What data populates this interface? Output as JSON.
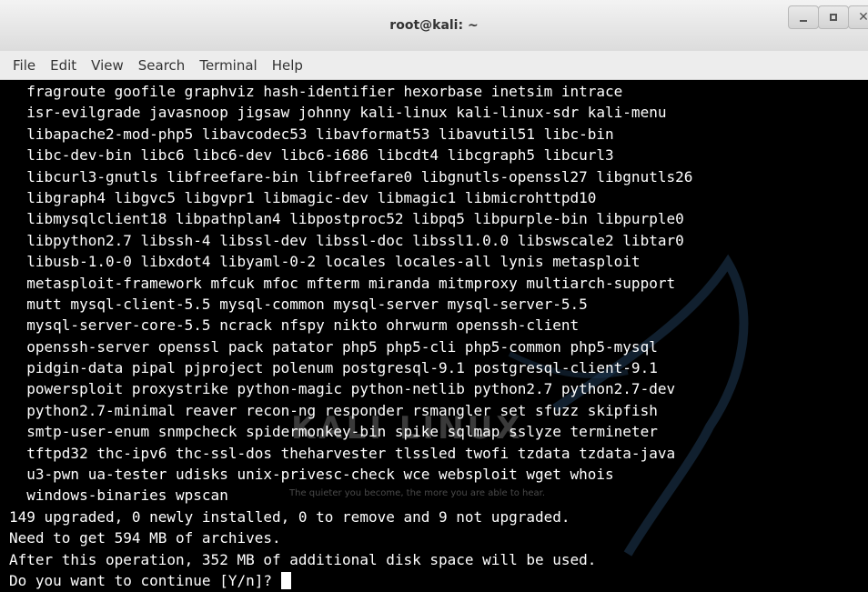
{
  "window": {
    "title": "root@kali: ~",
    "controls": {
      "minimize_glyph": "_",
      "maximize_glyph": "□",
      "close_glyph": "✕"
    }
  },
  "menubar": {
    "items": [
      "File",
      "Edit",
      "View",
      "Search",
      "Terminal",
      "Help"
    ]
  },
  "terminal": {
    "lines": [
      "  fragroute goofile graphviz hash-identifier hexorbase inetsim intrace",
      "  isr-evilgrade javasnoop jigsaw johnny kali-linux kali-linux-sdr kali-menu",
      "  libapache2-mod-php5 libavcodec53 libavformat53 libavutil51 libc-bin",
      "  libc-dev-bin libc6 libc6-dev libc6-i686 libcdt4 libcgraph5 libcurl3",
      "  libcurl3-gnutls libfreefare-bin libfreefare0 libgnutls-openssl27 libgnutls26",
      "  libgraph4 libgvc5 libgvpr1 libmagic-dev libmagic1 libmicrohttpd10",
      "  libmysqlclient18 libpathplan4 libpostproc52 libpq5 libpurple-bin libpurple0",
      "  libpython2.7 libssh-4 libssl-dev libssl-doc libssl1.0.0 libswscale2 libtar0",
      "  libusb-1.0-0 libxdot4 libyaml-0-2 locales locales-all lynis metasploit",
      "  metasploit-framework mfcuk mfoc mfterm miranda mitmproxy multiarch-support",
      "  mutt mysql-client-5.5 mysql-common mysql-server mysql-server-5.5",
      "  mysql-server-core-5.5 ncrack nfspy nikto ohrwurm openssh-client",
      "  openssh-server openssl pack patator php5 php5-cli php5-common php5-mysql",
      "  pidgin-data pipal pjproject polenum postgresql-9.1 postgresql-client-9.1",
      "  powersploit proxystrike python-magic python-netlib python2.7 python2.7-dev",
      "  python2.7-minimal reaver recon-ng responder rsmangler set sfuzz skipfish",
      "  smtp-user-enum snmpcheck spidermonkey-bin spike sqlmap sslyze termineter",
      "  tftpd32 thc-ipv6 thc-ssl-dos theharvester tlssled twofi tzdata tzdata-java",
      "  u3-pwn ua-tester udisks unix-privesc-check wce websploit wget whois",
      "  windows-binaries wpscan",
      "149 upgraded, 0 newly installed, 0 to remove and 9 not upgraded.",
      "Need to get 594 MB of archives.",
      "After this operation, 352 MB of additional disk space will be used."
    ],
    "prompt": "Do you want to continue [Y/n]? ",
    "watermark": {
      "title": "KALI LINUX",
      "tagline": "The quieter you become, the more you are able to hear."
    }
  }
}
